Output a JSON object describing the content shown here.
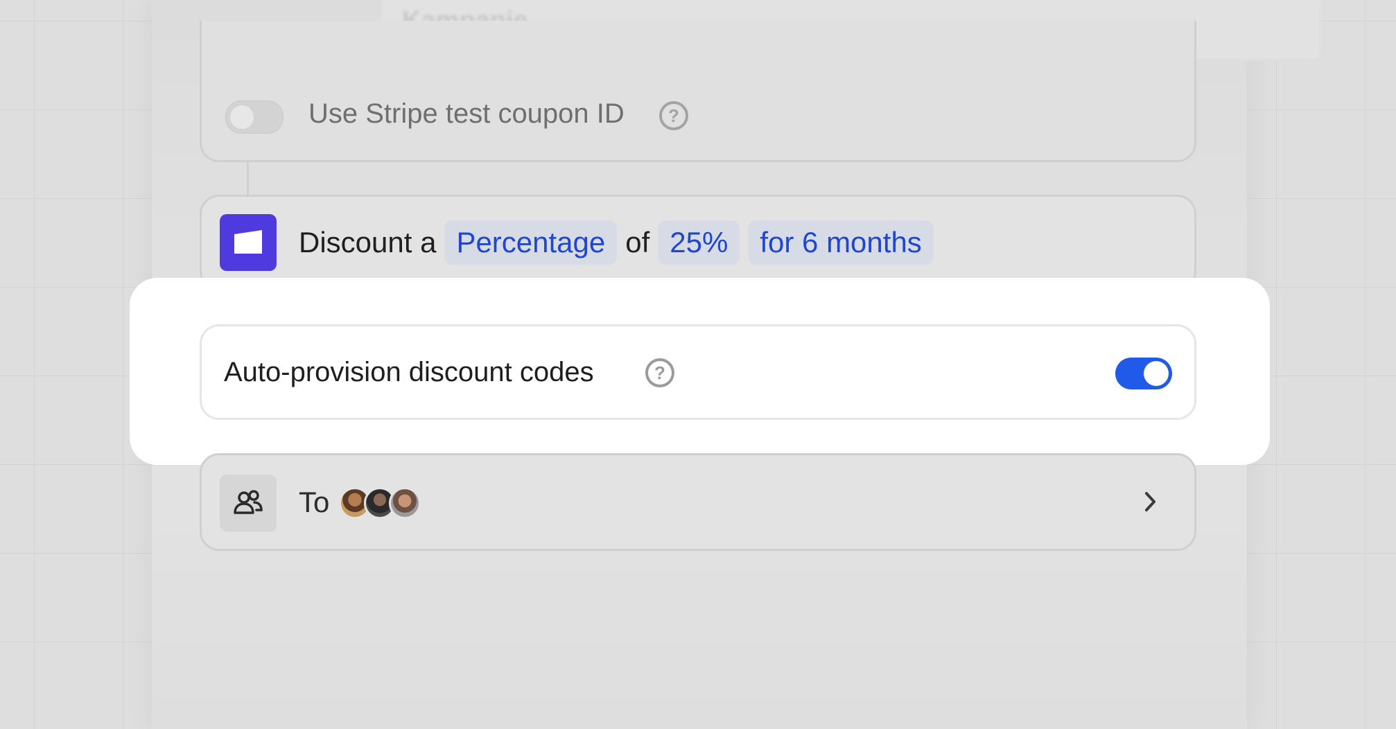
{
  "top_field": {
    "placeholder_text": "Kampanje"
  },
  "coupon": {
    "label": "Use Stripe test coupon ID",
    "enabled": false
  },
  "discount": {
    "prefix": "Discount a",
    "type_chip": "Percentage",
    "middle": "of",
    "amount_chip": "25%",
    "duration_chip": "for 6 months"
  },
  "auto_provision": {
    "label": "Auto-provision discount codes",
    "enabled": true
  },
  "recipients": {
    "label": "To",
    "avatars": [
      "avatar-1",
      "avatar-2",
      "avatar-3"
    ]
  },
  "colors": {
    "accent": "#1f5ae8",
    "chip_text": "#1f46d1",
    "app_icon": "#4f3ae0"
  }
}
